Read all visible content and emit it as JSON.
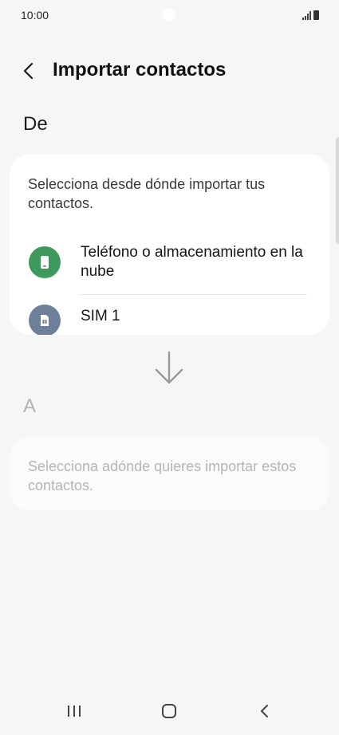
{
  "status_bar": {
    "time": "10:00",
    "icons": [
      "signal-icon",
      "battery-icon"
    ]
  },
  "header": {
    "back_icon": "chevron-left-icon",
    "title": "Importar contactos"
  },
  "from_section": {
    "label": "De",
    "description": "Selecciona desde dónde importar tus contactos.",
    "options": [
      {
        "label": "Teléfono o almacenamiento en la nube",
        "icon": "phone-icon",
        "icon_color": "#3e9a5c"
      },
      {
        "label": "SIM 1",
        "icon": "sim-card-icon",
        "icon_color": "#6d7f99"
      }
    ]
  },
  "arrow_icon": "arrow-down-icon",
  "to_section": {
    "label": "A",
    "description": "Selecciona adónde quieres importar estos contactos."
  },
  "nav_bar": {
    "buttons": [
      "recents-icon",
      "home-icon",
      "back-icon"
    ]
  }
}
